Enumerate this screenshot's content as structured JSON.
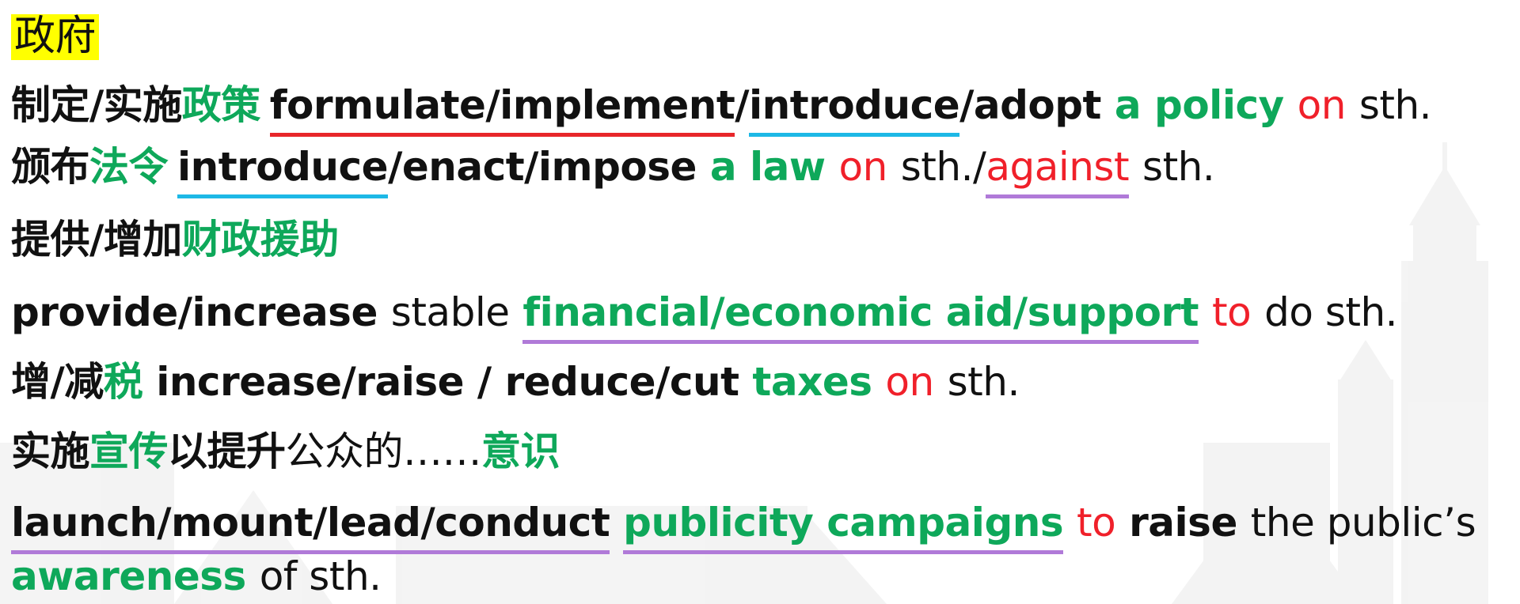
{
  "title": "政府",
  "line1": {
    "cn_a": "制定/实施",
    "cn_b": "政策",
    "verbs_1": "formulate/implement",
    "slash_1": "/",
    "verbs_2": "introduce",
    "verbs_3": "/adopt",
    "obj": "a policy",
    "prep": "on",
    "tail": "sth."
  },
  "line2": {
    "cn_a": "颁布",
    "cn_b": "法令",
    "verbs_1": "introduce",
    "verbs_2": "/enact/impose",
    "obj": "a law",
    "prep": "on",
    "mid": "sth./",
    "prep2": "against",
    "tail": "sth."
  },
  "line3": {
    "cn_a": "提供/增加",
    "cn_b": "财政援助"
  },
  "line4": {
    "verbs": "provide/increase",
    "adj": "stable",
    "obj": "financial/economic aid/support",
    "prep": "to",
    "tail": "do sth."
  },
  "line5": {
    "cn_a": "增/减",
    "cn_b": "税",
    "verbs": "increase/raise / reduce/cut",
    "obj": "taxes",
    "prep": "on",
    "tail": "sth."
  },
  "line6": {
    "cn_a": "实施",
    "cn_b": "宣传",
    "cn_c": "以提升",
    "cn_d": "公众的……",
    "cn_e": "意识"
  },
  "line7": {
    "verbs": "launch/mount/lead/conduct",
    "obj": "publicity campaigns",
    "prep": "to",
    "verb2": "raise",
    "tail": "the public’s"
  },
  "line8": {
    "obj": "awareness",
    "tail": "of sth."
  },
  "colors": {
    "green": "#0ea85a",
    "red": "#f0202a",
    "highlight": "#ffff00",
    "underline_red": "#e8262a",
    "underline_cyan": "#1db8e6",
    "underline_purple": "#b07ad8"
  }
}
